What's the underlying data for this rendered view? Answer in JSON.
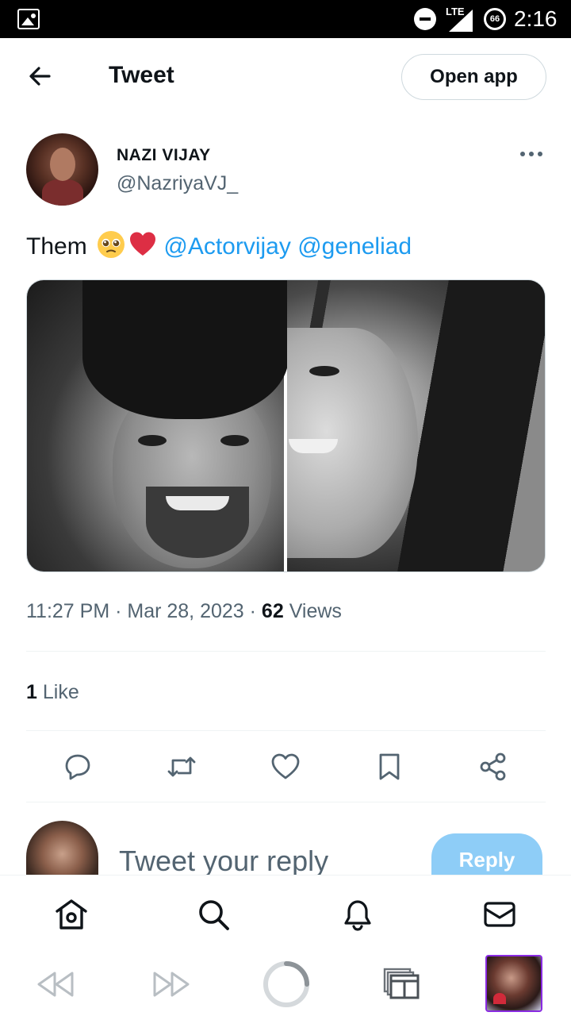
{
  "status_bar": {
    "network": "LTE",
    "battery": "66",
    "time": "2:16"
  },
  "header": {
    "title": "Tweet",
    "open_app_label": "Open app"
  },
  "tweet": {
    "author_name": "NAZI VIJAY",
    "author_handle": "@NazriyaVJ_",
    "text_prefix": "Them",
    "mentions": [
      "@Actorvijay",
      "@geneliad"
    ],
    "time": "11:27 PM",
    "date": "Mar 28, 2023",
    "views_count": "62",
    "views_label": "Views",
    "likes_count": "1",
    "likes_label": "Like"
  },
  "reply": {
    "placeholder": "Tweet your reply",
    "button_label": "Reply"
  },
  "colors": {
    "accent": "#1d9bf0",
    "reply_button": "#8ecdf7",
    "secondary_text": "#536471"
  },
  "icons": {
    "actions": [
      "reply-icon",
      "retweet-icon",
      "like-icon",
      "bookmark-icon",
      "share-icon"
    ],
    "nav": [
      "home-icon",
      "search-icon",
      "notifications-icon",
      "messages-icon"
    ],
    "browser": [
      "back-icon",
      "forward-icon",
      "loading-icon",
      "tabs-icon"
    ]
  }
}
